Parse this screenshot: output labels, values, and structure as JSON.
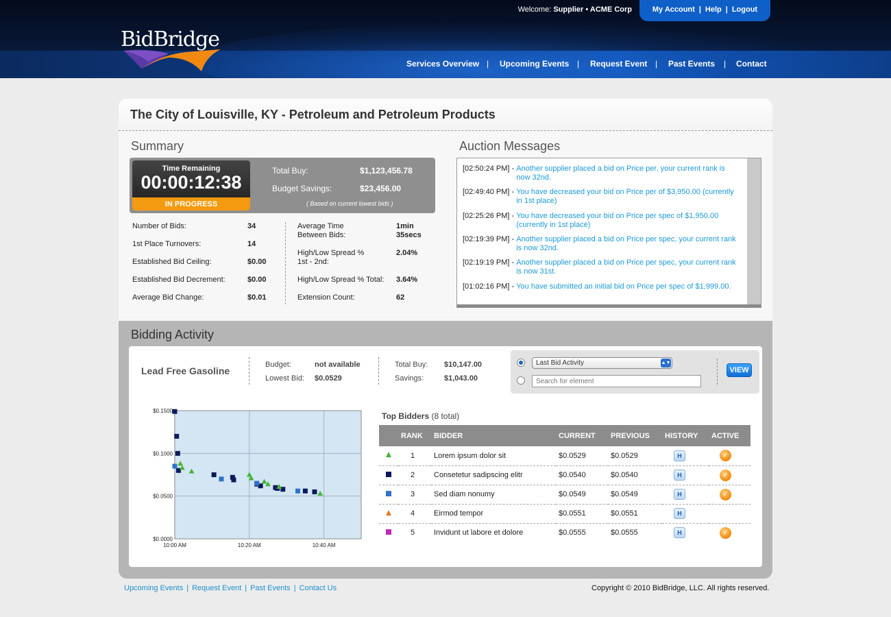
{
  "header": {
    "logo_text": "BidBridge",
    "welcome_prefix": "Welcome:",
    "welcome_user": "Supplier • ACME Corp",
    "account_links": [
      "My Account",
      "Help",
      "Logout"
    ],
    "nav": [
      "Services Overview",
      "Upcoming Events",
      "Request Event",
      "Past Events",
      "Contact"
    ]
  },
  "event": {
    "title": "The City of Louisville, KY - Petroleum and Petroleum Products"
  },
  "summary": {
    "heading": "Summary",
    "time_label": "Time Remaining",
    "time_value": "00:00:12:38",
    "status": "IN PROGRESS",
    "total_buy_label": "Total Buy:",
    "total_buy": "$1,123,456.78",
    "budget_savings_label": "Budget Savings:",
    "budget_savings": "$23,456.00",
    "note": "( Based on current lowest bids )",
    "stats_left": [
      {
        "label": "Number of Bids:",
        "value": "34"
      },
      {
        "label": "1st Place Turnovers:",
        "value": "14"
      },
      {
        "label": "Established Bid Ceiling:",
        "value": "$0.00"
      },
      {
        "label": "Established Bid Decrement:",
        "value": "$0.00"
      },
      {
        "label": "Average Bid Change:",
        "value": "$0.01"
      }
    ],
    "stats_right": [
      {
        "label": "Average Time\nBetween Bids:",
        "value": "1min\n35secs"
      },
      {
        "label": "High/Low Spread %\n1st - 2nd:",
        "value": "2.04%"
      },
      {
        "label": "High/Low Spread % Total:",
        "value": "3.64%"
      },
      {
        "label": "Extension Count:",
        "value": "62"
      }
    ]
  },
  "messages": {
    "heading": "Auction Messages",
    "items": [
      {
        "time": "[02:50:24 PM] -",
        "text": "Another supplier placed a bid on Price per, your current rank is now 32nd."
      },
      {
        "time": "[02:49:40 PM] -",
        "text": "You have decreased your bid on Price per of $3,950.00 (currently in 1st place)"
      },
      {
        "time": "[02:25:26 PM] -",
        "text": "You have decreased your bid on Price per spec of $1,950.00 (currently in 1st place)"
      },
      {
        "time": "[02:19:39 PM] -",
        "text": "Another supplier placed a bid on Price per spec, your current rank is now 32nd."
      },
      {
        "time": "[02:19:19 PM] -",
        "text": "Another supplier placed a bid on Price per spec, your current rank is now 31st."
      },
      {
        "time": "[01:02:16 PM] -",
        "text": "You have submitted an initial bid on Price per spec of $1,999.00."
      }
    ]
  },
  "bidding": {
    "heading": "Bidding Activity",
    "item_name": "Lead Free Gasoline",
    "budget_label": "Budget:",
    "budget": "not available",
    "lowest_bid_label": "Lowest Bid:",
    "lowest_bid": "$0.0529",
    "total_buy_label": "Total Buy:",
    "total_buy": "$10,147.00",
    "savings_label": "Savings:",
    "savings": "$1,043.00",
    "filter_select": "Last Bid Activity",
    "search_placeholder": "Search for element",
    "view_label": "VIEW"
  },
  "chart_data": {
    "type": "scatter",
    "title": "",
    "xlabel": "",
    "ylabel": "",
    "x_ticks": [
      "10:00 AM",
      "10:20 AM",
      "10:40 AM"
    ],
    "y_ticks": [
      "$0.0000",
      "$0.0500",
      "$0.1000",
      "$0.1500"
    ],
    "xlim": [
      0,
      50
    ],
    "ylim": [
      0,
      0.15
    ],
    "series": [
      {
        "color": "#3a3ac0",
        "marker": "triangle",
        "points": []
      },
      {
        "color": "#0b1a5c",
        "marker": "square",
        "points": [
          [
            0,
            0.149
          ],
          [
            0.5,
            0.12
          ],
          [
            0.8,
            0.1
          ],
          [
            1,
            0.08
          ],
          [
            10.5,
            0.075
          ],
          [
            15.5,
            0.072
          ],
          [
            15.8,
            0.069
          ],
          [
            22,
            0.064
          ],
          [
            23,
            0.062
          ],
          [
            27,
            0.06
          ],
          [
            27.5,
            0.059
          ],
          [
            29,
            0.058
          ],
          [
            35,
            0.056
          ],
          [
            37.5,
            0.055
          ]
        ]
      },
      {
        "color": "#2f73c9",
        "marker": "square",
        "points": [
          [
            0,
            0.085
          ],
          [
            12.5,
            0.07
          ],
          [
            22,
            0.065
          ],
          [
            33,
            0.056
          ]
        ]
      },
      {
        "color": "#44b536",
        "marker": "triangle",
        "points": [
          [
            1.5,
            0.088
          ],
          [
            2,
            0.083
          ],
          [
            4.5,
            0.079
          ],
          [
            20,
            0.075
          ],
          [
            20.5,
            0.071
          ],
          [
            24,
            0.067
          ],
          [
            25,
            0.064
          ],
          [
            28,
            0.061
          ],
          [
            39,
            0.053
          ]
        ]
      }
    ]
  },
  "top_bidders": {
    "title": "Top Bidders",
    "count": "(8 total)",
    "columns": [
      "RANK",
      "BIDDER",
      "CURRENT",
      "PREVIOUS",
      "HISTORY",
      "ACTIVE"
    ],
    "rows": [
      {
        "rank": "1",
        "bidder": "Lorem ipsum dolor sit",
        "current": "$0.0529",
        "previous": "$0.0529",
        "marker": "triangle",
        "color": "#44b536",
        "active": true
      },
      {
        "rank": "2",
        "bidder": "Consetetur sadipscing elitr",
        "current": "$0.0540",
        "previous": "$0.0540",
        "marker": "square",
        "color": "#0b1a5c",
        "active": true
      },
      {
        "rank": "3",
        "bidder": "Sed diam nonumy",
        "current": "$0.0549",
        "previous": "$0.0549",
        "marker": "square",
        "color": "#2f73c9",
        "active": true
      },
      {
        "rank": "4",
        "bidder": "Eirmod tempor",
        "current": "$0.0551",
        "previous": "$0.0551",
        "marker": "triangle",
        "color": "#e07a2a",
        "active": false
      },
      {
        "rank": "5",
        "bidder": "Invidunt ut labore et dolore",
        "current": "$0.0555",
        "previous": "$0.0555",
        "marker": "square",
        "color": "#c02ab8",
        "active": true
      }
    ],
    "history_label": "H"
  },
  "footer": {
    "links": [
      "Upcoming Events",
      "Request Event",
      "Past Events",
      "Contact Us"
    ],
    "copyright": "Copyright © 2010 BidBridge, LLC.  All rights reserved."
  }
}
